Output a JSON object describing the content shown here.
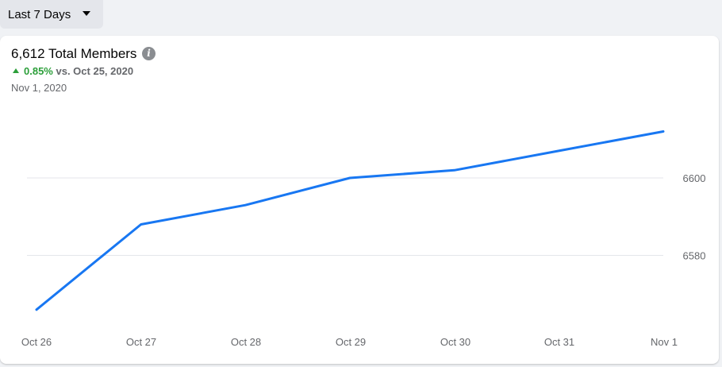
{
  "filter": {
    "range_label": "Last 7 Days"
  },
  "metric": {
    "title": "6,612 Total Members",
    "change_pct": "0.85%",
    "change_vs": "vs. Oct 25, 2020",
    "date": "Nov 1, 2020",
    "info_icon": "info-icon"
  },
  "colors": {
    "line": "#1877f2",
    "positive": "#2c9f3a"
  },
  "chart_data": {
    "type": "line",
    "categories": [
      "Oct 26",
      "Oct 27",
      "Oct 28",
      "Oct 29",
      "Oct 30",
      "Oct 31",
      "Nov 1"
    ],
    "series": [
      {
        "values": [
          6566,
          6588,
          6593,
          6600,
          6602,
          6607,
          6612
        ]
      }
    ],
    "yticks": [
      6580,
      6600
    ],
    "ylim": [
      6563.5,
      6616
    ],
    "grid": true,
    "y_axis_side": "right",
    "title": "",
    "xlabel": "",
    "ylabel": ""
  }
}
